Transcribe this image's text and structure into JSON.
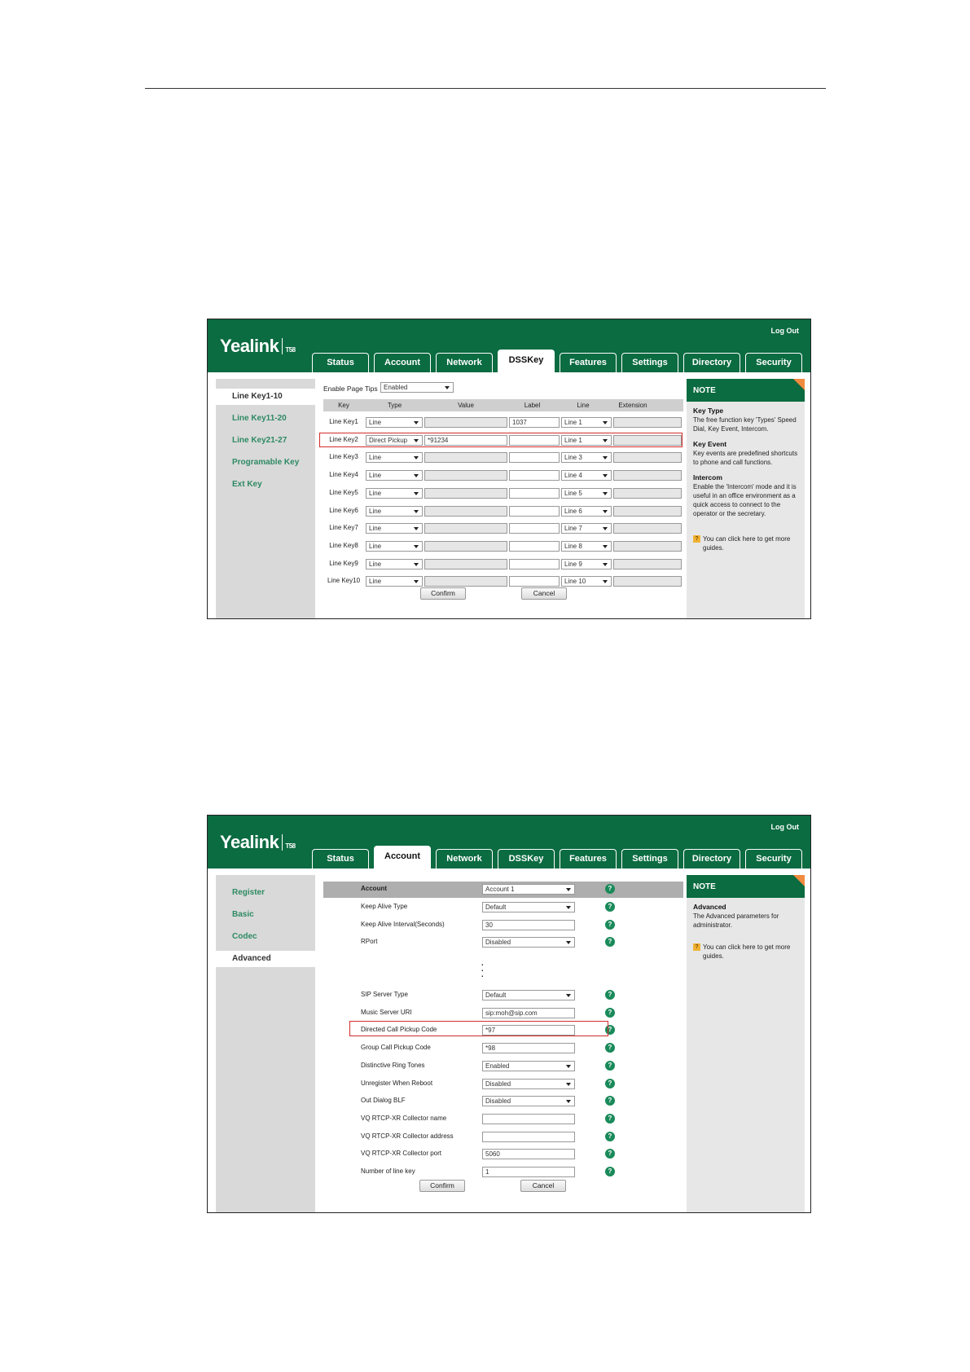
{
  "brand": {
    "logo": "Yealink",
    "model": "T58"
  },
  "logout": "Log Out",
  "tabs": [
    "Status",
    "Account",
    "Network",
    "DSSKey",
    "Features",
    "Settings",
    "Directory",
    "Security"
  ],
  "screen1": {
    "active_tab": "DSSKey",
    "sidebar": [
      "Line Key1-10",
      "Line Key11-20",
      "Line Key21-27",
      "Programable Key",
      "Ext Key"
    ],
    "enable_page_tips": {
      "label": "Enable Page Tips",
      "value": "Enabled"
    },
    "columns": [
      "Key",
      "Type",
      "Value",
      "Label",
      "Line",
      "Extension"
    ],
    "rows": [
      {
        "key": "Line Key1",
        "type": "Line",
        "value": "",
        "label": "1037",
        "line": "Line 1"
      },
      {
        "key": "Line Key2",
        "type": "Direct Pickup",
        "value": "*91234",
        "label": "",
        "line": "Line 1"
      },
      {
        "key": "Line Key3",
        "type": "Line",
        "value": "",
        "label": "",
        "line": "Line 3"
      },
      {
        "key": "Line Key4",
        "type": "Line",
        "value": "",
        "label": "",
        "line": "Line 4"
      },
      {
        "key": "Line Key5",
        "type": "Line",
        "value": "",
        "label": "",
        "line": "Line 5"
      },
      {
        "key": "Line Key6",
        "type": "Line",
        "value": "",
        "label": "",
        "line": "Line 6"
      },
      {
        "key": "Line Key7",
        "type": "Line",
        "value": "",
        "label": "",
        "line": "Line 7"
      },
      {
        "key": "Line Key8",
        "type": "Line",
        "value": "",
        "label": "",
        "line": "Line 8"
      },
      {
        "key": "Line Key9",
        "type": "Line",
        "value": "",
        "label": "",
        "line": "Line 9"
      },
      {
        "key": "Line Key10",
        "type": "Line",
        "value": "",
        "label": "",
        "line": "Line 10"
      }
    ],
    "confirm": "Confirm",
    "cancel": "Cancel",
    "note": {
      "title": "NOTE",
      "sections": [
        {
          "title": "Key Type",
          "text": "The free function key 'Types' Speed Dial, Key Event, Intercom."
        },
        {
          "title": "Key Event",
          "text": "Key events are predefined shortcuts to phone and call functions."
        },
        {
          "title": "Intercom",
          "text": "Enable the 'Intercom' mode and it is useful in an office environment as a quick access to connect to the operator or the secretary."
        }
      ],
      "guide": "You can click here to get more guides."
    }
  },
  "screen2": {
    "active_tab": "Account",
    "sidebar": [
      "Register",
      "Basic",
      "Codec",
      "Advanced"
    ],
    "account": {
      "label": "Account",
      "value": "Account 1"
    },
    "fields_top": [
      {
        "label": "Keep Alive Type",
        "value": "Default",
        "kind": "select"
      },
      {
        "label": "Keep Alive Interval(Seconds)",
        "value": "30",
        "kind": "input"
      },
      {
        "label": "RPort",
        "value": "Disabled",
        "kind": "select"
      }
    ],
    "fields_bottom": [
      {
        "label": "SIP Server Type",
        "value": "Default",
        "kind": "select"
      },
      {
        "label": "Music Server URI",
        "value": "sip:moh@sip.com",
        "kind": "input"
      },
      {
        "label": "Directed Call Pickup Code",
        "value": "*97",
        "kind": "input"
      },
      {
        "label": "Group Call Pickup Code",
        "value": "*98",
        "kind": "input"
      },
      {
        "label": "Distinctive Ring Tones",
        "value": "Enabled",
        "kind": "select"
      },
      {
        "label": "Unregister When Reboot",
        "value": "Disabled",
        "kind": "select"
      },
      {
        "label": "Out Dialog BLF",
        "value": "Disabled",
        "kind": "select"
      },
      {
        "label": "VQ RTCP-XR Collector name",
        "value": "",
        "kind": "input"
      },
      {
        "label": "VQ RTCP-XR Collector address",
        "value": "",
        "kind": "input"
      },
      {
        "label": "VQ RTCP-XR Collector port",
        "value": "5060",
        "kind": "input"
      },
      {
        "label": "Number of line key",
        "value": "1",
        "kind": "input"
      }
    ],
    "help_glyph": "?",
    "confirm": "Confirm",
    "cancel": "Cancel",
    "note": {
      "title": "NOTE",
      "sections": [
        {
          "title": "Advanced",
          "text": "The Advanced parameters for administrator."
        }
      ],
      "guide": "You can click here to get more guides."
    }
  }
}
